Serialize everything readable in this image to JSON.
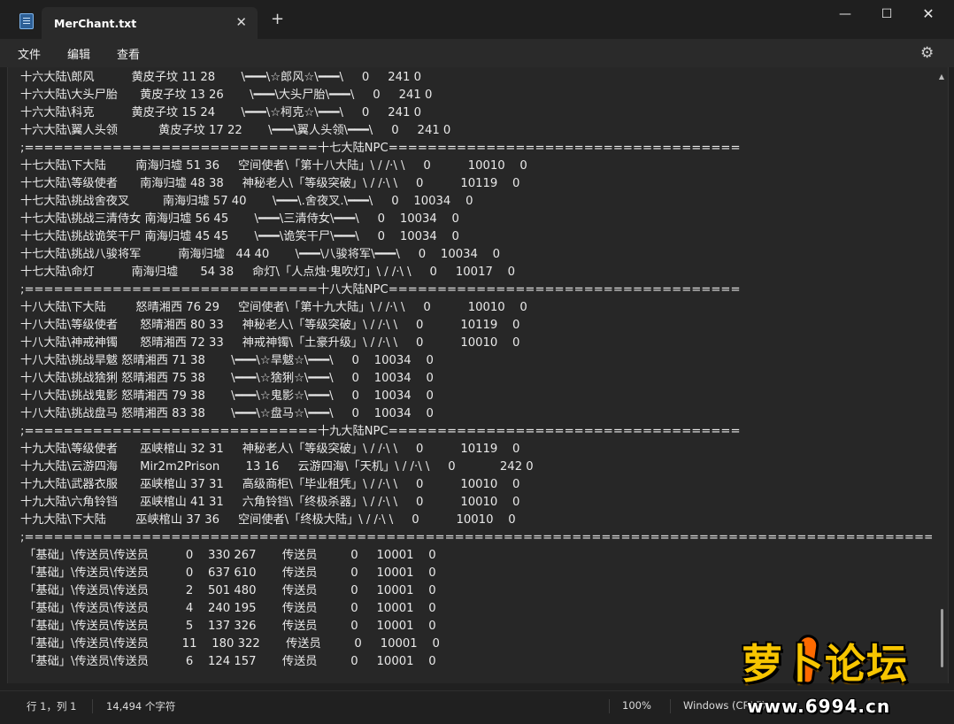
{
  "window": {
    "tab_title": "MerChant.txt",
    "tab_close": "✕",
    "new_tab": "+",
    "minimize": "—",
    "maximize": "☐",
    "close": "✕"
  },
  "menu": {
    "file": "文件",
    "edit": "编辑",
    "view": "查看",
    "settings_icon": "⚙"
  },
  "editor": {
    "lines": [
      "十六大陆\\郎风          黄皮子坟 11 28       \\━━━\\☆郎风☆\\━━━\\     0     241 0",
      "十六大陆\\大头尸胎      黄皮子坟 13 26       \\━━━\\大头尸胎\\━━━\\     0     241 0",
      "十六大陆\\科克          黄皮子坟 15 24       \\━━━\\☆柯克☆\\━━━\\     0     241 0",
      "十六大陆\\翼人头领           黄皮子坟 17 22       \\━━━\\翼人头领\\━━━\\     0     241 0",
      ";==============================十七大陆NPC====================================",
      "十七大陆\\下大陆        南海归墟 51 36     空间使者\\「第十八大陆」\\ / /·\\ \\     0          10010    0",
      "十七大陆\\等级使者      南海归墟 48 38     神秘老人\\「等级突破」\\ / /·\\ \\     0          10119    0",
      "十七大陆\\挑战舍夜叉         南海归墟 57 40       \\━━━\\.舍夜叉.\\━━━\\     0    10034    0",
      "十七大陆\\挑战三清侍女 南海归墟 56 45       \\━━━\\三清侍女\\━━━\\     0    10034    0",
      "十七大陆\\挑战诡笑干尸 南海归墟 45 45       \\━━━\\诡笑干尸\\━━━\\     0    10034    0",
      "十七大陆\\挑战八骏将军          南海归墟   44 40       \\━━━\\八骏将军\\━━━\\     0    10034    0",
      "十七大陆\\命灯          南海归墟      54 38     命灯\\「人点烛·鬼吹灯」\\ / /·\\ \\     0     10017    0",
      ";==============================十八大陆NPC====================================",
      "十八大陆\\下大陆        怒晴湘西 76 29     空间使者\\「第十九大陆」\\ / /·\\ \\     0          10010    0",
      "十八大陆\\等级使者      怒晴湘西 80 33     神秘老人\\「等级突破」\\ / /·\\ \\     0          10119    0",
      "十八大陆\\神戒神镯      怒晴湘西 72 33     神戒神镯\\「土豪升级」\\ / /·\\ \\     0          10010    0",
      "十八大陆\\挑战旱魃 怒晴湘西 71 38       \\━━━\\☆旱魃☆\\━━━\\     0    10034    0",
      "十八大陆\\挑战猞猁 怒晴湘西 75 38       \\━━━\\☆猞猁☆\\━━━\\     0    10034    0",
      "十八大陆\\挑战鬼影 怒晴湘西 79 38       \\━━━\\☆鬼影☆\\━━━\\     0    10034    0",
      "十八大陆\\挑战盘马 怒晴湘西 83 38       \\━━━\\☆盘马☆\\━━━\\     0    10034    0",
      ";==============================十九大陆NPC====================================",
      "十九大陆\\等级使者      巫峡棺山 32 31     神秘老人\\「等级突破」\\ / /·\\ \\     0          10119    0",
      "十九大陆\\云游四海      Mir2m2Prison       13 16     云游四海\\「天机」\\ / /·\\ \\     0            242 0",
      "十九大陆\\武器衣服      巫峡棺山 37 31     高级商柜\\「毕业租凭」\\ / /·\\ \\     0          10010    0",
      "十九大陆\\六角铃铛      巫峡棺山 41 31     六角铃铛\\「终极杀器」\\ / /·\\ \\     0          10010    0",
      "十九大陆\\下大陆        巫峡棺山 37 36     空间使者\\「终极大陆」\\ / /·\\ \\     0          10010    0",
      ";==============================================================================================",
      " 「基础」\\传送员\\传送员          0    330 267       传送员         0     10001    0",
      " 「基础」\\传送员\\传送员          0    637 610       传送员         0     10001    0",
      " 「基础」\\传送员\\传送员          2    501 480       传送员         0     10001    0",
      " 「基础」\\传送员\\传送员          4    240 195       传送员         0     10001    0",
      " 「基础」\\传送员\\传送员          5    137 326       传送员         0     10001    0",
      " 「基础」\\传送员\\传送员         11    180 322       传送员         0     10001    0",
      " 「基础」\\传送员\\传送员          6    124 157       传送员         0     10001    0"
    ]
  },
  "status": {
    "position": "行 1，列 1",
    "char_count": "14,494 个字符",
    "zoom": "100%",
    "line_ending": "Windows (CRLF)"
  },
  "watermark": {
    "title": "萝卜论坛",
    "url": "www.6994.cn"
  }
}
